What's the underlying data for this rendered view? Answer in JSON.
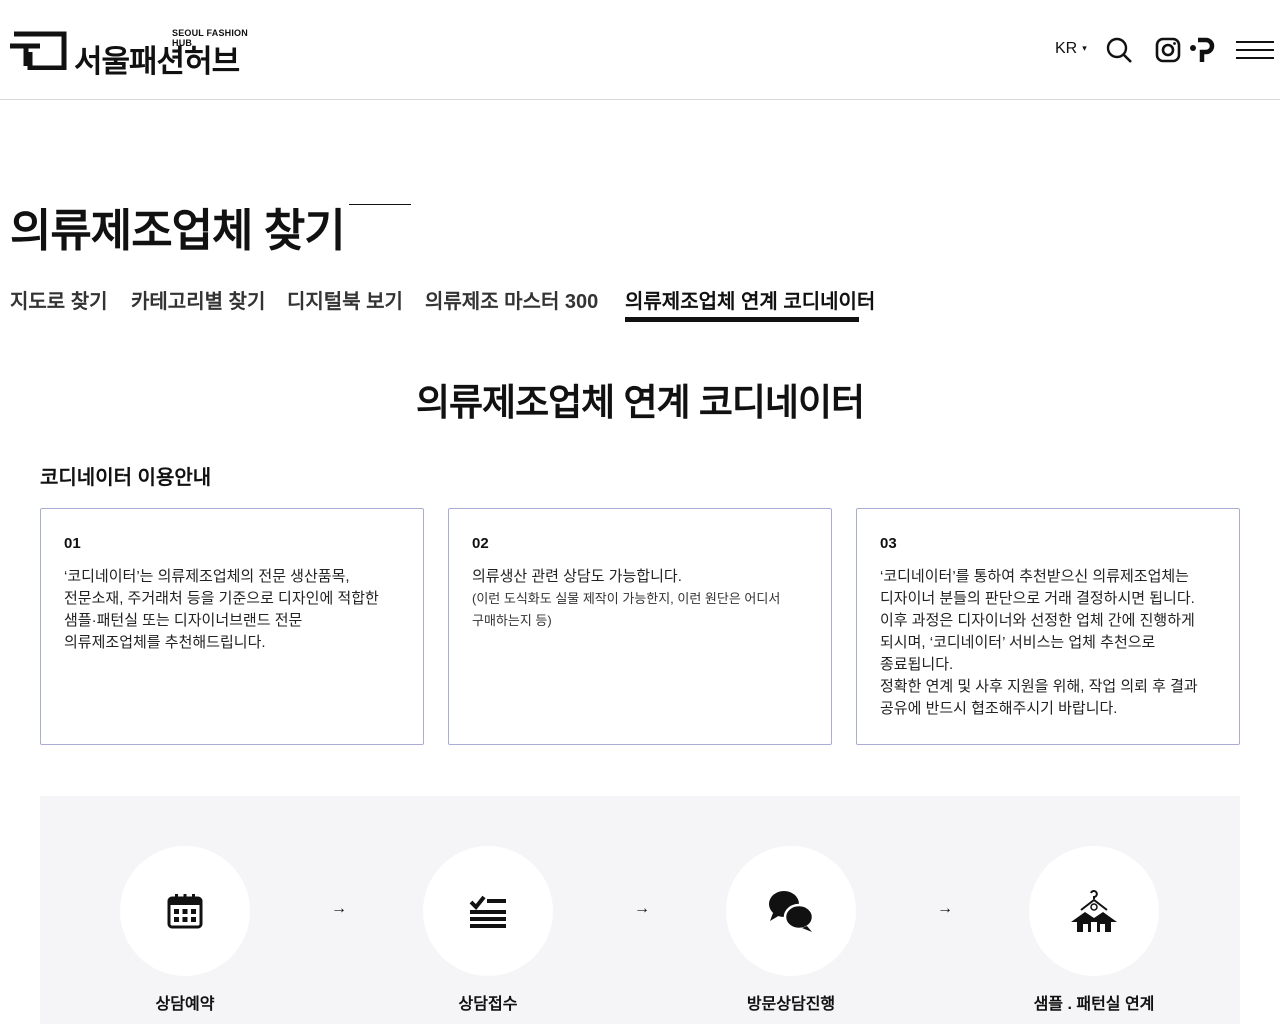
{
  "header": {
    "logo_sub": "SEOUL FASHION HUB",
    "logo_main": "서울패션허브",
    "lang": "KR",
    "icons": [
      "search-icon",
      "instagram-icon",
      "p-brand-icon",
      "menu-icon"
    ]
  },
  "page": {
    "title": "의류제조업체 찾기"
  },
  "tabs": [
    {
      "label": "지도로 찾기"
    },
    {
      "label": "카테고리별 찾기"
    },
    {
      "label": "디지털북 보기"
    },
    {
      "label": "의류제조 마스터 300"
    },
    {
      "label": "의류제조업체 연계 코디네이터",
      "active": true
    }
  ],
  "section": {
    "title": "의류제조업체 연계 코디네이터",
    "guide_title": "코디네이터 이용안내"
  },
  "cards": [
    {
      "num": "01",
      "text": "‘코디네이터’는 의류제조업체의 전문 생산품목,\n전문소재, 주거래처 등을 기준으로 디자인에 적합한\n샘플·패턴실 또는 디자이너브랜드 전문\n의류제조업체를 추천해드립니다.",
      "note": ""
    },
    {
      "num": "02",
      "text": "의류생산 관련 상담도 가능합니다.",
      "note": "(이런 도식화도 실물 제작이 가능한지, 이런 원단은 어디서\n구매하는지 등)"
    },
    {
      "num": "03",
      "text": "‘코디네이터’를 통하여 추천받으신 의류제조업체는\n디자이너 분들의 판단으로 거래 결정하시면 됩니다.\n이후 과정은 디자이너와 선정한 업체 간에 진행하게\n되시며, ‘코디네이터’ 서비스는 업체 추천으로\n종료됩니다.\n정확한 연계 및 사후 지원을 위해, 작업 의뢰 후 결과\n공유에 반드시 협조해주시기 바랍니다.",
      "note": ""
    }
  ],
  "process": {
    "steps": [
      {
        "label": "상담예약",
        "icon": "calendar-icon"
      },
      {
        "label": "상담접수",
        "icon": "checklist-icon"
      },
      {
        "label": "방문상담진행",
        "icon": "chat-bubbles-icon"
      },
      {
        "label": "샘플 . 패턴실 연계",
        "icon": "hanger-house-icon"
      }
    ],
    "arrow": "→"
  }
}
